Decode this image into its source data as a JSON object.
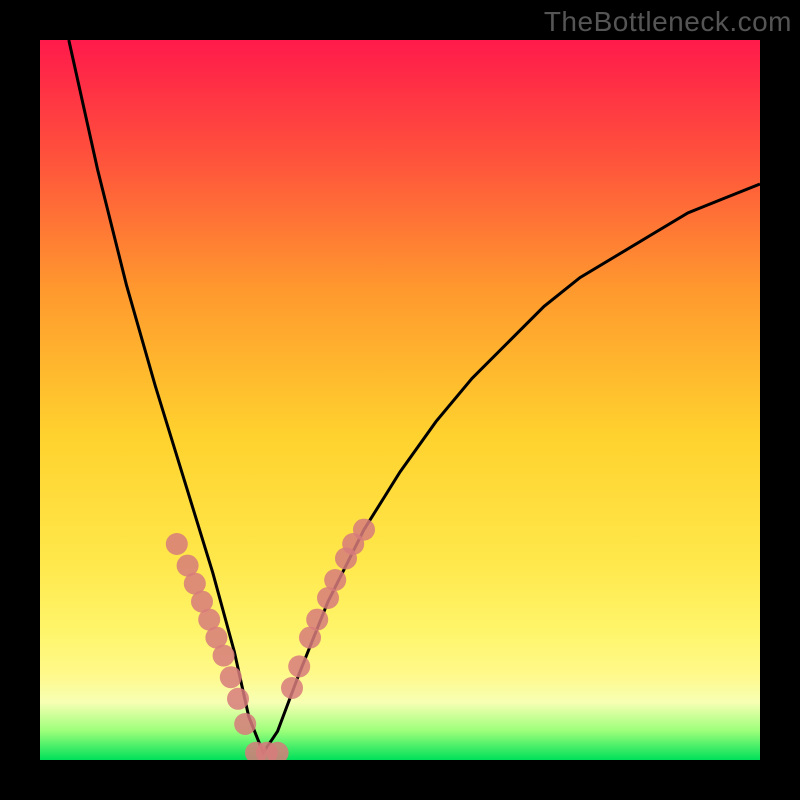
{
  "watermark": "TheBottleneck.com",
  "chart_data": {
    "type": "line",
    "title": "",
    "xlabel": "",
    "ylabel": "",
    "xlim": [
      0,
      100
    ],
    "ylim": [
      0,
      100
    ],
    "background_gradient": [
      "#ff1a4b",
      "#ff4d3d",
      "#ff9a2e",
      "#ffd22e",
      "#ffe74a",
      "#fff56a",
      "#fff98a",
      "#f7ffb3",
      "#9bff7a",
      "#00e05a"
    ],
    "curve_note": "V-shaped bottleneck curve; minimum near x≈30, y≈0; left branch steep to top-left corner; right branch rises toward upper-right, reaching roughly y≈80 at x≈100",
    "series": [
      {
        "name": "bottleneck-curve",
        "x": [
          4,
          8,
          12,
          16,
          20,
          24,
          27,
          29,
          31,
          33,
          36,
          40,
          45,
          50,
          55,
          60,
          65,
          70,
          75,
          80,
          85,
          90,
          95,
          100
        ],
        "y": [
          100,
          82,
          66,
          52,
          39,
          26,
          15,
          6,
          1,
          4,
          12,
          22,
          32,
          40,
          47,
          53,
          58,
          63,
          67,
          70,
          73,
          76,
          78,
          80
        ]
      }
    ],
    "markers": [
      {
        "name": "left-branch-dots",
        "x": [
          19,
          20.5,
          21.5,
          22.5,
          23.5,
          24.5,
          25.5,
          26.5,
          27.5,
          28.5,
          30,
          31.5,
          33
        ],
        "y": [
          30,
          27,
          24.5,
          22,
          19.5,
          17,
          14.5,
          11.5,
          8.5,
          5,
          1,
          1,
          1
        ]
      },
      {
        "name": "right-branch-dots",
        "x": [
          35,
          36,
          37.5,
          38.5,
          40,
          41,
          42.5,
          43.5,
          45
        ],
        "y": [
          10,
          13,
          17,
          19.5,
          22.5,
          25,
          28,
          30,
          32
        ]
      }
    ],
    "colors": {
      "curve": "#000000",
      "marker": "#d77b7b",
      "frame": "#000000"
    }
  }
}
